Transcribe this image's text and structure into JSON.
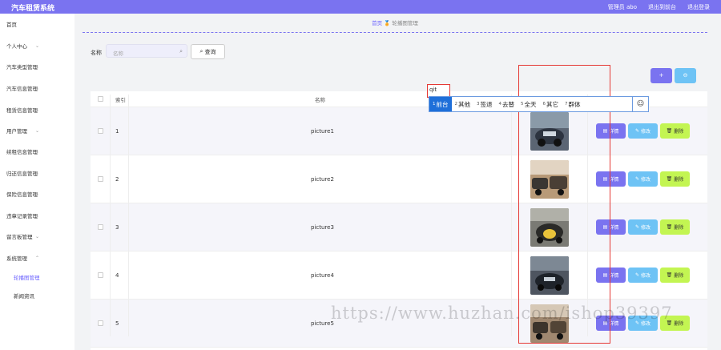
{
  "header": {
    "brand": "汽车租赁系统",
    "admin_label": "管理员 abo",
    "exit_to_front": "退出到前台",
    "logout": "退出登录"
  },
  "sidebar": {
    "items": [
      {
        "label": "首页"
      },
      {
        "label": "个人中心"
      },
      {
        "label": "汽车类型管理"
      },
      {
        "label": "汽车信息管理"
      },
      {
        "label": "租赁信息管理"
      },
      {
        "label": "用户管理"
      },
      {
        "label": "续租信息管理"
      },
      {
        "label": "归还信息管理"
      },
      {
        "label": "保险信息管理"
      },
      {
        "label": "违章记录管理"
      },
      {
        "label": "留言板管理"
      },
      {
        "label": "系统管理"
      }
    ],
    "sub_items": [
      {
        "label": "轮播图管理"
      },
      {
        "label": "新闻资讯"
      }
    ]
  },
  "breadcrumb": {
    "home": "首页",
    "current": "轮播图管理"
  },
  "search": {
    "label": "名称",
    "placeholder": "名称",
    "button": "查询"
  },
  "toolbar": {
    "add": "+",
    "delete": "⊖"
  },
  "table": {
    "headers": {
      "index": "索引",
      "name": "名称"
    },
    "rows": [
      {
        "index": "1",
        "name": "picture1"
      },
      {
        "index": "2",
        "name": "picture2"
      },
      {
        "index": "3",
        "name": "picture3"
      },
      {
        "index": "4",
        "name": "picture4"
      },
      {
        "index": "5",
        "name": "picture5"
      }
    ],
    "actions": {
      "detail": "详情",
      "edit": "修改",
      "remove": "删除"
    }
  },
  "ime": {
    "typed": "qit",
    "candidates": [
      {
        "num": "1",
        "text": "前台"
      },
      {
        "num": "2",
        "text": "其他"
      },
      {
        "num": "3",
        "text": "签退"
      },
      {
        "num": "4",
        "text": "去替"
      },
      {
        "num": "5",
        "text": "全天"
      },
      {
        "num": "6",
        "text": "其它"
      },
      {
        "num": "7",
        "text": "群体"
      }
    ]
  },
  "watermark": "https://www.huzhan.com/ishop39397",
  "colors": {
    "primary": "#7a73f0",
    "info": "#6ec3f5",
    "danger": "#c3f552",
    "annotation": "#e53935"
  }
}
